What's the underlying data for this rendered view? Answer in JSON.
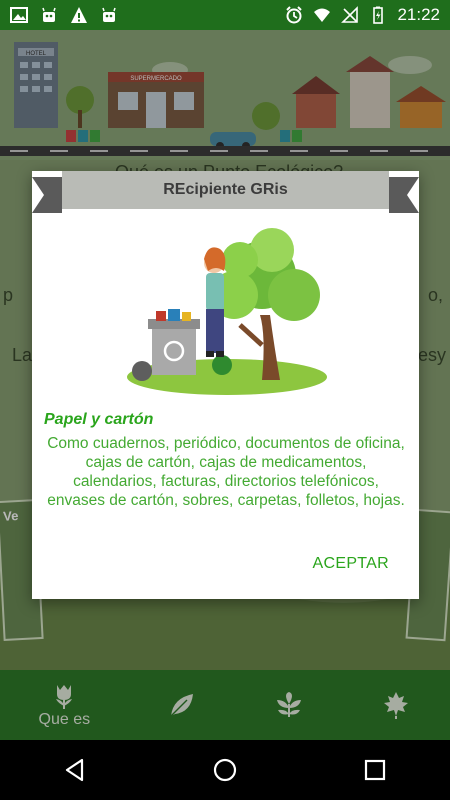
{
  "status_bar": {
    "time": "21:22"
  },
  "background": {
    "hotel_sign": "HOTEL",
    "store_sign": "SUPERMERCADO",
    "line1": "Qué es un Punto Ecológico?",
    "line2_left": "p",
    "line2_right": "o,",
    "line3_left": "La",
    "line3_right": "esy",
    "card_left_text": "Ve"
  },
  "dialog": {
    "title": "REcipiente GRis",
    "category_title": "Papel y cartón",
    "description": "Como cuadernos, periódico, documentos de oficina, cajas de cartón, cajas de medicamentos, calendarios, facturas, directorios telefónicos, envases de cartón, sobres, carpetas, folletos, hojas.",
    "accept_label": "ACEPTAR"
  },
  "bottom_nav": {
    "items": [
      {
        "label": "Que es",
        "icon": "flower-icon"
      },
      {
        "label": "",
        "icon": "leaf-icon"
      },
      {
        "label": "",
        "icon": "sprout-icon"
      },
      {
        "label": "",
        "icon": "maple-leaf-icon"
      }
    ]
  },
  "colors": {
    "primary": "#2e7a29",
    "accent": "#2aa51c",
    "status_bar": "#1f6e1c"
  }
}
